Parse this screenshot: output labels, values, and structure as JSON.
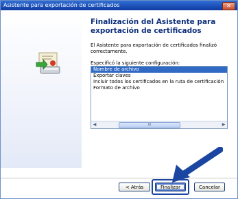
{
  "window": {
    "title": "Asistente para exportación de certificados"
  },
  "main": {
    "heading": "Finalización del Asistente para exportación de certificados",
    "message": "El Asistente para exportación de certificados finalizó correctamente.",
    "config_label": "Especificó la siguiente configuración:",
    "settings": [
      "Nombre de archivo",
      "Exportar claves",
      "Incluir todos los certificados en la ruta de certificación",
      "Formato de archivo"
    ],
    "scrollbar_thumb_label": "III"
  },
  "buttons": {
    "back": "< Atrás",
    "finish": "Finalizar",
    "cancel": "Cancelar"
  },
  "colors": {
    "title_bar": "#0f3aa0",
    "heading": "#0d2f7a",
    "selection": "#316ac5",
    "arrow": "#1a45a0"
  },
  "icons": {
    "wizard_graphic": "certificate-export-icon",
    "pointer": "arrow-pointer-icon"
  }
}
